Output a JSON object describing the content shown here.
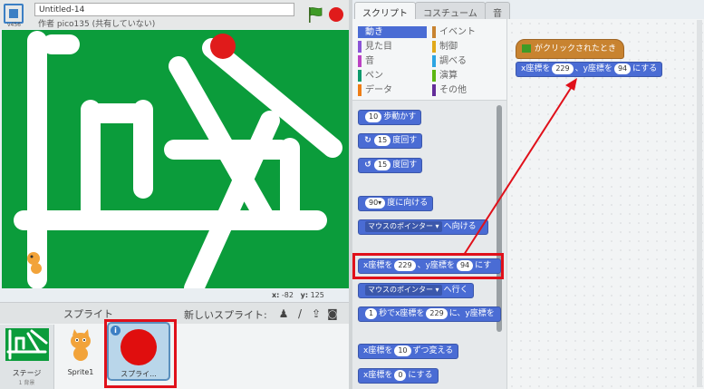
{
  "project": {
    "version": "v456",
    "title": "Untitled-14",
    "author": "作者 pico135 (共有していない)"
  },
  "stage": {
    "background_color": "#0b9c3b",
    "mouse_x_label": "x:",
    "mouse_x": "-82",
    "mouse_y_label": "y:",
    "mouse_y": "125"
  },
  "sprites_panel": {
    "header": "スプライト",
    "new_sprite_label": "新しいスプライト:",
    "new_sprite_icons": [
      "person-icon",
      "paintbrush-icon",
      "upload-icon",
      "camera-icon"
    ],
    "stage_thumb_label": "ステージ",
    "stage_thumb_sub": "1 背景",
    "items": [
      {
        "name": "Sprite1"
      },
      {
        "name": "スプライ..."
      }
    ]
  },
  "tabs": [
    {
      "label": "スクリプト",
      "active": true
    },
    {
      "label": "コスチューム",
      "active": false
    },
    {
      "label": "音",
      "active": false
    }
  ],
  "categories": [
    {
      "label": "動き",
      "color": "#4a6cd4",
      "selected": true
    },
    {
      "label": "イベント",
      "color": "#c88330",
      "selected": false
    },
    {
      "label": "見た目",
      "color": "#8a55d7",
      "selected": false
    },
    {
      "label": "制御",
      "color": "#e1a91a",
      "selected": false
    },
    {
      "label": "音",
      "color": "#bb42c3",
      "selected": false
    },
    {
      "label": "調べる",
      "color": "#2ca5e2",
      "selected": false
    },
    {
      "label": "ペン",
      "color": "#0e9a6c",
      "selected": false
    },
    {
      "label": "演算",
      "color": "#5cb712",
      "selected": false
    },
    {
      "label": "データ",
      "color": "#ee7d16",
      "selected": false
    },
    {
      "label": "その他",
      "color": "#632d99",
      "selected": false
    }
  ],
  "blocks": {
    "move": {
      "val": "10",
      "text": "歩動かす"
    },
    "turn_cw": {
      "val": "15",
      "text": "度回す"
    },
    "turn_ccw": {
      "val": "15",
      "text": "度回す"
    },
    "point_dir": {
      "val": "90▾",
      "text": "度に向ける"
    },
    "point_towards": {
      "dropdown": "マウスのポインター ▾",
      "text": "へ向ける"
    },
    "goto_xy": {
      "x_label": "x座標を",
      "x_val": "229",
      "sep": "、y座標を",
      "y_val": "94",
      "text": "にす"
    },
    "goto": {
      "dropdown": "マウスのポインター ▾",
      "text": "へ行く"
    },
    "glide": {
      "secs": "1",
      "text1": "秒でx座標を",
      "x_val": "229",
      "text2": "に、y座標を"
    },
    "change_x": {
      "label": "x座標を",
      "val": "10",
      "text": "ずつ変える"
    },
    "set_x": {
      "label": "x座標を",
      "val": "0",
      "text": "にする"
    }
  },
  "script": {
    "hat_label": "がクリックされたとき",
    "goto": {
      "x_label": "x座標を",
      "x_val": "229",
      "sep": "、y座標を",
      "y_val": "94",
      "text": "にする"
    }
  },
  "colors": {
    "motion": "#4a6cd4",
    "event": "#c88330",
    "highlight": "#e0101a"
  }
}
